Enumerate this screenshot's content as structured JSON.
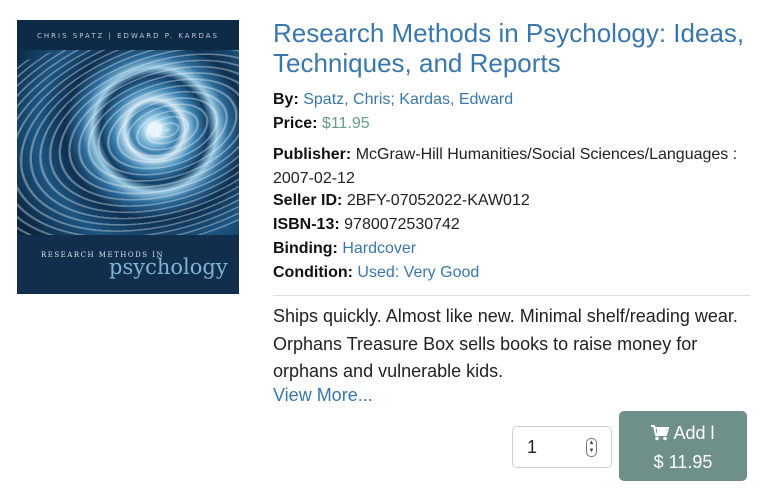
{
  "book": {
    "title": "Research Methods in Psychology: Ideas, Techniques, and Reports",
    "cover": {
      "authors_line": "CHRIS SPATZ  |  EDWARD P. KARDAS",
      "series_line": "RESEARCH METHODS IN",
      "subject_line": "psychology"
    }
  },
  "fields": {
    "by_label": "By:",
    "by_value": "Spatz, Chris; Kardas, Edward",
    "price_label": "Price:",
    "price_value": "$11.95",
    "publisher_label": "Publisher:",
    "publisher_value": "McGraw-Hill Humanities/Social Sciences/Languages : 2007-02-12",
    "seller_label": "Seller ID:",
    "seller_value": "2BFY-07052022-KAW012",
    "isbn_label": "ISBN-13:",
    "isbn_value": "9780072530742",
    "binding_label": "Binding:",
    "binding_value": "Hardcover",
    "condition_label": "Condition:",
    "condition_value": "Used: Very Good"
  },
  "description": {
    "text": "Ships quickly. Almost like new. Minimal shelf/reading wear. Orphans Treasure Box sells books to raise money for orphans and vulnerable kids.",
    "view_more": "View More..."
  },
  "cart": {
    "quantity": "1",
    "add_label": "Add l",
    "add_price": "$ 11.95",
    "icon": "cart-icon"
  },
  "colors": {
    "link": "#3a77ac",
    "button": "#6f8f8b",
    "price": "#6a9a88"
  }
}
